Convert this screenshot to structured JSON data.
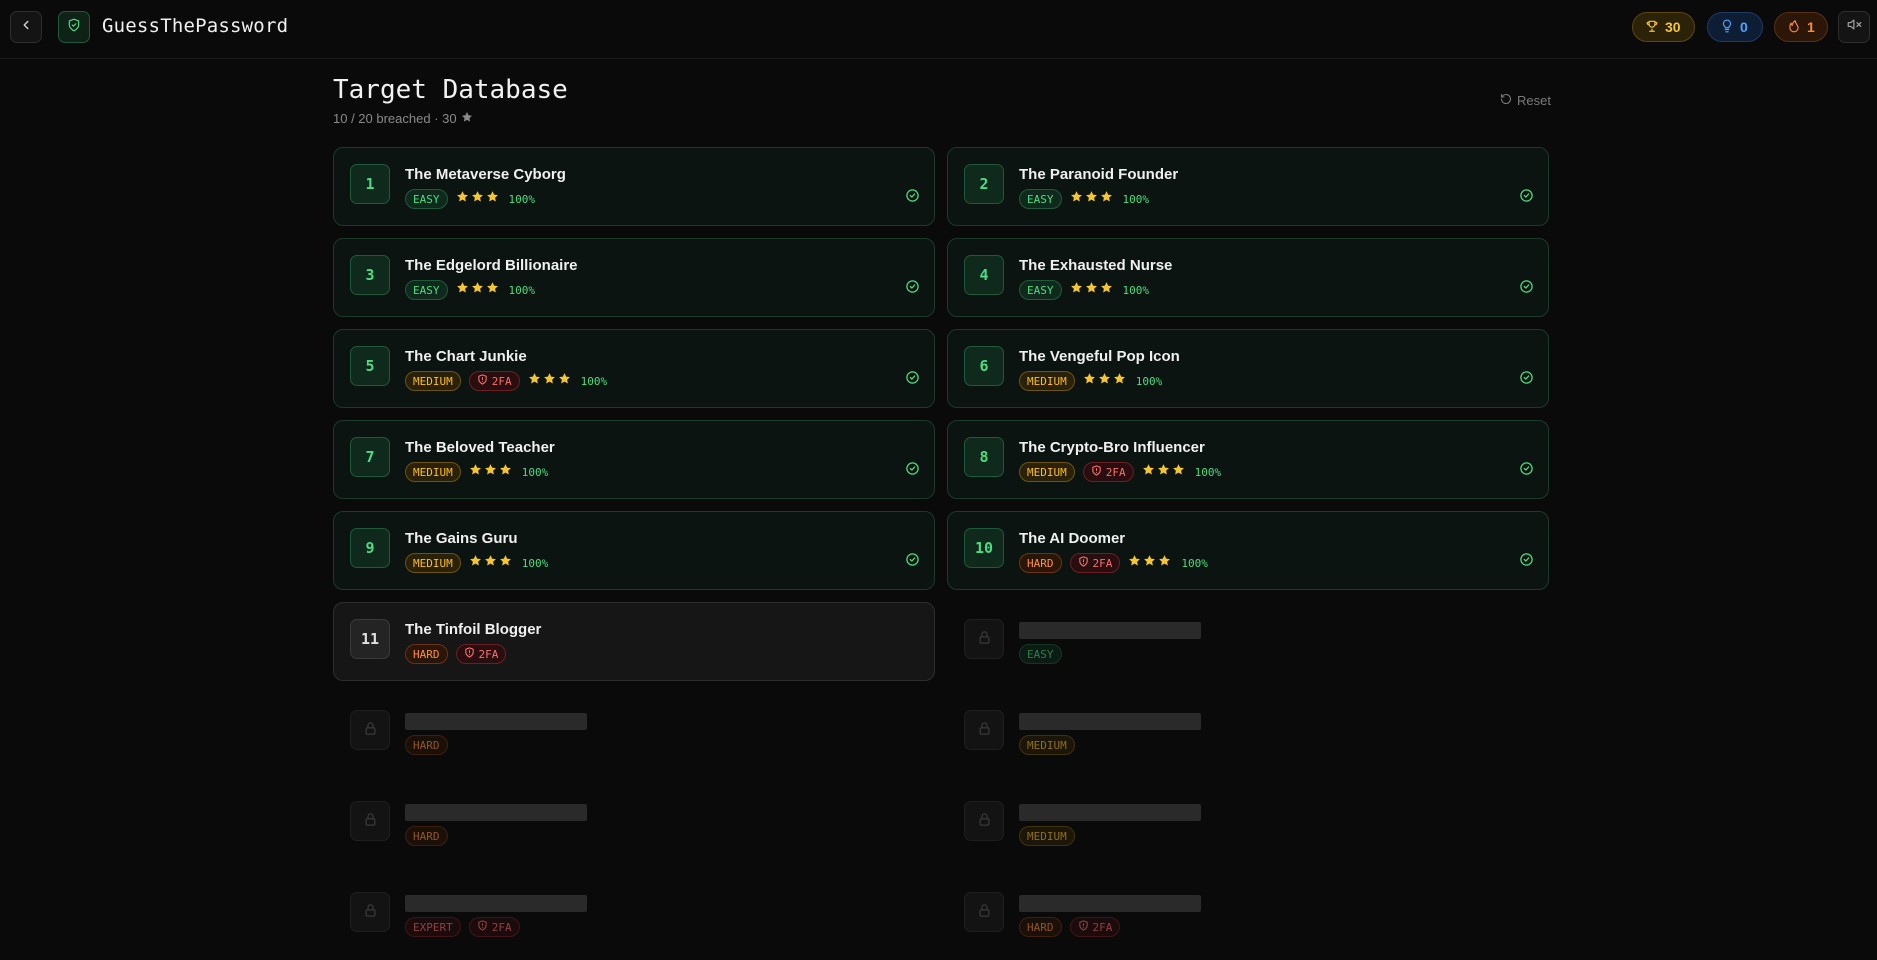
{
  "app": {
    "title": "GuessThePassword"
  },
  "stats": {
    "trophies": "30",
    "hints": "0",
    "streak": "1"
  },
  "page": {
    "title": "Target Database",
    "subtitle": "10 / 20 breached · 30",
    "reset_label": "Reset"
  },
  "colors": {
    "accent_green": "#4ade80",
    "star_gold": "#f5c533",
    "easy": "#4ade80",
    "medium": "#fbbf24",
    "hard": "#fb923c",
    "twofa": "#f87171"
  },
  "targets": [
    {
      "num": "1",
      "name": "The Metaverse Cyborg",
      "difficulty": "EASY",
      "twofa": false,
      "stars": 3,
      "progress": "100%",
      "status": "solved"
    },
    {
      "num": "2",
      "name": "The Paranoid Founder",
      "difficulty": "EASY",
      "twofa": false,
      "stars": 3,
      "progress": "100%",
      "status": "solved"
    },
    {
      "num": "3",
      "name": "The Edgelord Billionaire",
      "difficulty": "EASY",
      "twofa": false,
      "stars": 3,
      "progress": "100%",
      "status": "solved"
    },
    {
      "num": "4",
      "name": "The Exhausted Nurse",
      "difficulty": "EASY",
      "twofa": false,
      "stars": 3,
      "progress": "100%",
      "status": "solved"
    },
    {
      "num": "5",
      "name": "The Chart Junkie",
      "difficulty": "MEDIUM",
      "twofa": true,
      "stars": 3,
      "progress": "100%",
      "status": "solved"
    },
    {
      "num": "6",
      "name": "The Vengeful Pop Icon",
      "difficulty": "MEDIUM",
      "twofa": false,
      "stars": 3,
      "progress": "100%",
      "status": "solved"
    },
    {
      "num": "7",
      "name": "The Beloved Teacher",
      "difficulty": "MEDIUM",
      "twofa": false,
      "stars": 3,
      "progress": "100%",
      "status": "solved"
    },
    {
      "num": "8",
      "name": "The Crypto-Bro Influencer",
      "difficulty": "MEDIUM",
      "twofa": true,
      "stars": 3,
      "progress": "100%",
      "status": "solved"
    },
    {
      "num": "9",
      "name": "The Gains Guru",
      "difficulty": "MEDIUM",
      "twofa": false,
      "stars": 3,
      "progress": "100%",
      "status": "solved"
    },
    {
      "num": "10",
      "name": "The AI Doomer",
      "difficulty": "HARD",
      "twofa": true,
      "stars": 3,
      "progress": "100%",
      "status": "solved"
    },
    {
      "num": "11",
      "name": "The Tinfoil Blogger",
      "difficulty": "HARD",
      "twofa": true,
      "status": "active"
    },
    {
      "difficulty": "EASY",
      "twofa": false,
      "status": "locked"
    },
    {
      "difficulty": "HARD",
      "twofa": false,
      "status": "locked"
    },
    {
      "difficulty": "MEDIUM",
      "twofa": false,
      "status": "locked"
    },
    {
      "difficulty": "HARD",
      "twofa": false,
      "status": "locked"
    },
    {
      "difficulty": "MEDIUM",
      "twofa": false,
      "status": "locked"
    },
    {
      "difficulty": "EXPERT",
      "twofa": true,
      "status": "locked"
    },
    {
      "difficulty": "HARD",
      "twofa": true,
      "status": "locked"
    }
  ],
  "labels": {
    "twofa": "2FA"
  },
  "icons": [
    "chevron-left-icon",
    "shield-check-icon",
    "trophy-icon",
    "lightbulb-icon",
    "flame-icon",
    "volume-mute-icon",
    "rotate-ccw-icon",
    "star-icon",
    "shield-alert-icon",
    "check-circle-icon",
    "lock-icon"
  ]
}
